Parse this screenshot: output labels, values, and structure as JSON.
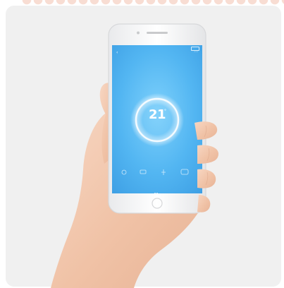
{
  "screen": {
    "status_time": "",
    "nav": {
      "back": "‹",
      "title": "",
      "more": "⋯"
    },
    "temperature": {
      "value": "21",
      "unit": "°",
      "mode": ""
    },
    "info": {
      "line1": "",
      "line2": ""
    },
    "controls": [
      "",
      "",
      "",
      ""
    ],
    "icons": {
      "back": "chevron-left-icon",
      "more": "more-icon",
      "power": "power-icon",
      "mode": "mode-icon",
      "fan": "fan-icon",
      "schedule": "schedule-icon"
    }
  },
  "colors": {
    "screen_blue": "#4fb1ef",
    "card_background": "#f0f0f0",
    "skin": "#f2c7ae"
  }
}
